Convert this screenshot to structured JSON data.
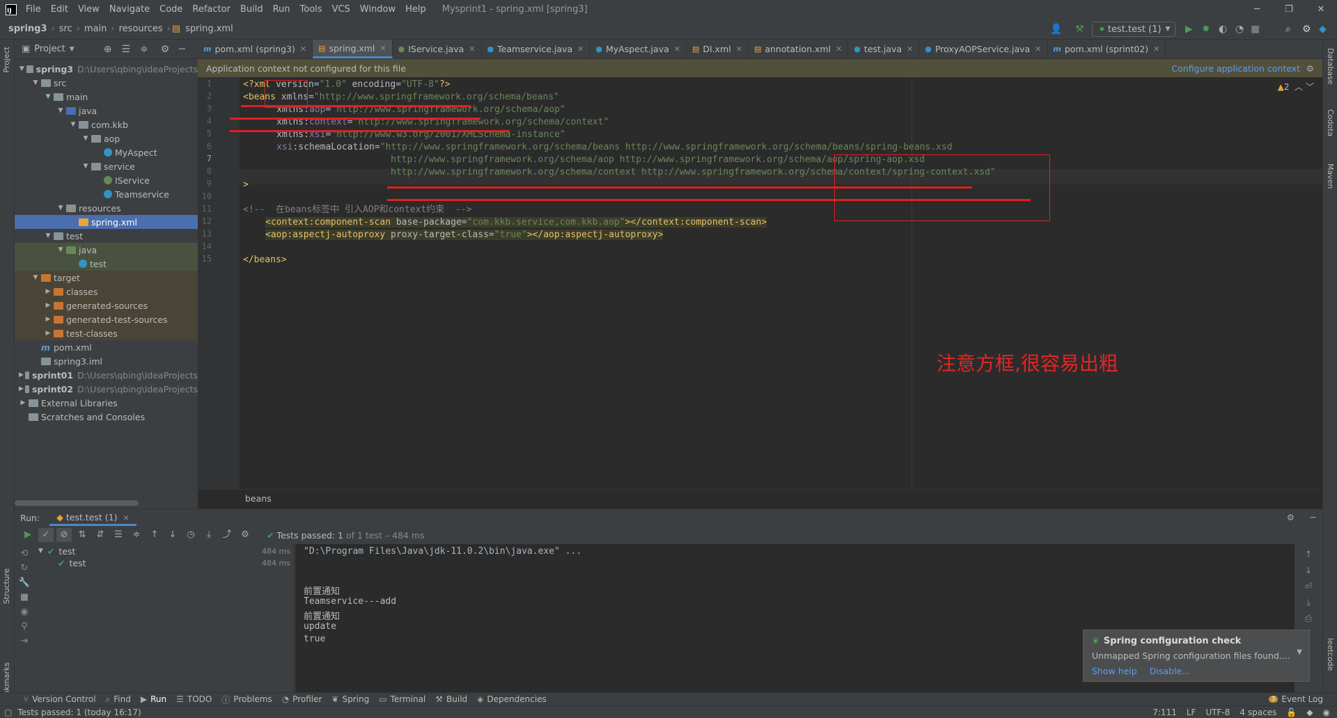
{
  "menubar": {
    "items": [
      "File",
      "Edit",
      "View",
      "Navigate",
      "Code",
      "Refactor",
      "Build",
      "Run",
      "Tools",
      "VCS",
      "Window",
      "Help"
    ],
    "window_title": "Mysprint1 - spring.xml [spring3]"
  },
  "navbar": {
    "crumbs": [
      "spring3",
      "src",
      "main",
      "resources",
      "spring.xml"
    ],
    "run_config": "test.test (1)"
  },
  "project": {
    "title": "Project",
    "tree": [
      {
        "label": "spring3",
        "path": "D:\\Users\\qbing\\IdeaProjects",
        "depth": 0,
        "arrow": "v",
        "icon": "fold",
        "bold": true
      },
      {
        "label": "src",
        "depth": 1,
        "arrow": "v",
        "icon": "fold"
      },
      {
        "label": "main",
        "depth": 2,
        "arrow": "v",
        "icon": "fold"
      },
      {
        "label": "java",
        "depth": 3,
        "arrow": "v",
        "icon": "fold-src"
      },
      {
        "label": "com.kkb",
        "depth": 4,
        "arrow": "v",
        "icon": "fold"
      },
      {
        "label": "aop",
        "depth": 5,
        "arrow": "v",
        "icon": "fold"
      },
      {
        "label": "MyAspect",
        "depth": 6,
        "arrow": "",
        "icon": "cls"
      },
      {
        "label": "service",
        "depth": 5,
        "arrow": "v",
        "icon": "fold"
      },
      {
        "label": "IService",
        "depth": 6,
        "arrow": "",
        "icon": "ifc"
      },
      {
        "label": "Teamservice",
        "depth": 6,
        "arrow": "",
        "icon": "cls"
      },
      {
        "label": "resources",
        "depth": 3,
        "arrow": "v",
        "icon": "fold-res"
      },
      {
        "label": "spring.xml",
        "depth": 4,
        "arrow": "",
        "icon": "xmlf",
        "selected": true
      },
      {
        "label": "test",
        "depth": 2,
        "arrow": "v",
        "icon": "fold"
      },
      {
        "label": "java",
        "depth": 3,
        "arrow": "v",
        "icon": "fold-test",
        "bg": "test"
      },
      {
        "label": "test",
        "depth": 4,
        "arrow": "",
        "icon": "cls",
        "bg": "test"
      },
      {
        "label": "target",
        "depth": 1,
        "arrow": "v",
        "icon": "fold-tgt",
        "bg": "target"
      },
      {
        "label": "classes",
        "depth": 2,
        "arrow": ">",
        "icon": "fold-tgt",
        "bg": "target"
      },
      {
        "label": "generated-sources",
        "depth": 2,
        "arrow": ">",
        "icon": "fold-tgt",
        "bg": "target"
      },
      {
        "label": "generated-test-sources",
        "depth": 2,
        "arrow": ">",
        "icon": "fold-tgt",
        "bg": "target"
      },
      {
        "label": "test-classes",
        "depth": 2,
        "arrow": ">",
        "icon": "fold-tgt",
        "bg": "target"
      },
      {
        "label": "pom.xml",
        "depth": 1,
        "arrow": "",
        "icon": "mvn"
      },
      {
        "label": "spring3.iml",
        "depth": 1,
        "arrow": "",
        "icon": "fold"
      },
      {
        "label": "sprint01",
        "path": "D:\\Users\\qbing\\IdeaProjects",
        "depth": 0,
        "arrow": ">",
        "icon": "fold",
        "bold": true
      },
      {
        "label": "sprint02",
        "path": "D:\\Users\\qbing\\IdeaProjects",
        "depth": 0,
        "arrow": ">",
        "icon": "fold",
        "bold": true
      },
      {
        "label": "External Libraries",
        "depth": 0,
        "arrow": ">",
        "icon": "fold"
      },
      {
        "label": "Scratches and Consoles",
        "depth": 0,
        "arrow": "",
        "icon": "fold"
      }
    ]
  },
  "tabs": [
    {
      "label": "pom.xml (spring3)",
      "icon": "m"
    },
    {
      "label": "spring.xml",
      "icon": "x",
      "active": true
    },
    {
      "label": "IService.java",
      "icon": "I"
    },
    {
      "label": "Teamservice.java",
      "icon": "C"
    },
    {
      "label": "MyAspect.java",
      "icon": "C"
    },
    {
      "label": "DI.xml",
      "icon": "x"
    },
    {
      "label": "annotation.xml",
      "icon": "x"
    },
    {
      "label": "test.java",
      "icon": "C"
    },
    {
      "label": "ProxyAOPService.java",
      "icon": "C"
    },
    {
      "label": "pom.xml (sprint02)",
      "icon": "m"
    }
  ],
  "ctxbar": {
    "message": "Application context not configured for this file",
    "action": "Configure application context"
  },
  "editor": {
    "warning_count": "2",
    "lines": [
      "1",
      "2",
      "3",
      "4",
      "5",
      "6",
      "7",
      "8",
      "9",
      "10",
      "11",
      "12",
      "13",
      "14",
      "15"
    ],
    "code": {
      "l1a": "<?xml ",
      "l1b": "version",
      "l1c": "=",
      "l1d": "\"1.0\"",
      "l1e": " encoding",
      "l1f": "=",
      "l1g": "\"UTF-8\"",
      "l1h": "?>",
      "l2a": "<beans ",
      "l2b": "xmlns",
      "l2c": "=",
      "l2d": "\"http://www.springframework.org/schema/beans\"",
      "l3a": "xmlns:",
      "l3b": "aop",
      "l3c": "=",
      "l3d": "\"http://www.springframework.org/schema/aop\"",
      "l4a": "xmlns:",
      "l4b": "context",
      "l4c": "=",
      "l4d": "\"http://www.springframework.org/schema/context\"",
      "l5a": "xmlns:",
      "l5b": "xsi",
      "l5c": "=",
      "l5d": "\"http://www.w3.org/2001/XMLSchema-instance\"",
      "l6a": "xsi",
      "l6b": ":schemaLocation",
      "l6c": "=",
      "l6d": "\"http://www.springframework.org/schema/beans http://www.springframework.org/schema/beans/spring-beans.xsd",
      "l7": "http://www.springframework.org/schema/aop http://www.springframework.org/schema/aop/spring-aop.xsd",
      "l8": "http://www.springframework.org/schema/context http://www.springframework.org/schema/context/spring-context.xsd\"",
      "l9": ">",
      "l11": "<!--  在beans标签中 引入AOP和context约束  -->",
      "l12a": "<context",
      ":": ":",
      "l12b": "component-scan ",
      "l12c": "base-package",
      "l12d": "=",
      "l12e": "\"com.kkb.service,com.kkb.aop\"",
      "l12f": "></context",
      "l12g": "component-scan",
      "l12h": ">",
      "l13a": "<aop",
      "l13b": "aspectj-autoproxy ",
      "l13c": "proxy-target-class",
      "l13d": "=",
      "l13e": "\"true\"",
      "l13f": "></aop",
      "l13g": "aspectj-autoproxy",
      "l13h": ">",
      "l15": "</beans>"
    },
    "annotation": "注意方框,很容易出粗"
  },
  "breadcrumb_bottom": "beans",
  "run": {
    "label": "Run:",
    "tab": "test.test (1)",
    "status_prefix": "Tests passed: ",
    "status_count": "1",
    "status_suffix": " of 1 test – 484 ms",
    "tree": [
      {
        "label": "test",
        "time": "484 ms"
      },
      {
        "label": "test",
        "time": "484 ms"
      }
    ],
    "console": [
      "\"D:\\Program Files\\Java\\jdk-11.0.2\\bin\\java.exe\" ...",
      "",
      "",
      "前置通知",
      "Teamservice---add",
      "前置通知",
      "update",
      "true"
    ]
  },
  "notification": {
    "title": "Spring configuration check",
    "body": "Unmapped Spring configuration files found....",
    "actions": [
      "Show help",
      "Disable..."
    ]
  },
  "bottom_tools": [
    "Version Control",
    "Find",
    "Run",
    "TODO",
    "Problems",
    "Profiler",
    "Spring",
    "Terminal",
    "Build",
    "Dependencies"
  ],
  "event_log": {
    "label": "Event Log",
    "count": "3"
  },
  "side": {
    "left": [
      "Project",
      "Structure",
      "Bookmarks"
    ],
    "right": [
      "Database",
      "Codota",
      "Maven",
      "leetcode"
    ]
  },
  "status": {
    "message": "Tests passed: 1 (today 16:17)",
    "position": "7:111",
    "line_sep": "LF",
    "encoding": "UTF-8",
    "indent": "4 spaces"
  }
}
